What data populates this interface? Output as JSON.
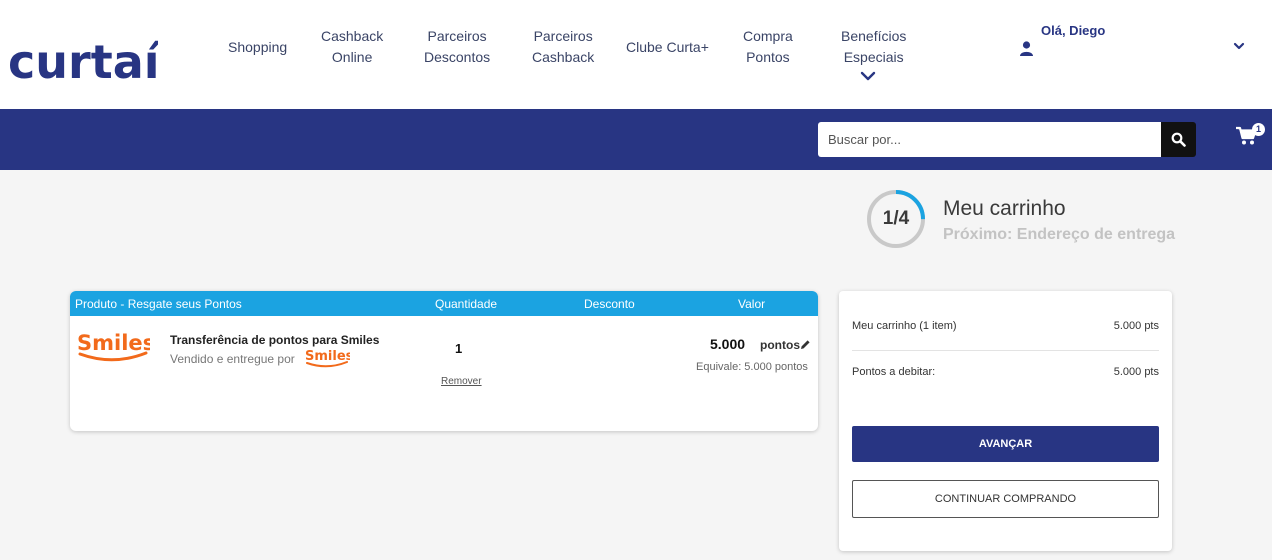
{
  "header": {
    "logo_text": "curtaí",
    "nav": [
      {
        "label_1": "Shopping",
        "label_2": ""
      },
      {
        "label_1": "Cashback",
        "label_2": "Online"
      },
      {
        "label_1": "Parceiros",
        "label_2": "Descontos"
      },
      {
        "label_1": "Parceiros",
        "label_2": "Cashback"
      },
      {
        "label_1": "Clube Curta+",
        "label_2": ""
      },
      {
        "label_1": "Compra",
        "label_2": "Pontos"
      },
      {
        "label_1": "Benefícios",
        "label_2": "Especiais"
      }
    ],
    "user": {
      "greeting": "Olá, Diego"
    }
  },
  "search": {
    "placeholder": "Buscar por..."
  },
  "cart": {
    "count": "1"
  },
  "steps": {
    "counter": "1/4",
    "title": "Meu carrinho",
    "next": "Próximo: Endereço de entrega",
    "progress": 0.25
  },
  "product_table": {
    "headers": {
      "product": "Produto - Resgate seus Pontos",
      "quantity": "Quantidade",
      "discount": "Desconto",
      "value": "Valor"
    },
    "items": [
      {
        "brand": "Smiles",
        "name": "Transferência de pontos para Smiles",
        "seller_prefix": "Vendido e entregue por",
        "seller_brand": "Smiles",
        "quantity": "1",
        "remove_label": "Remover",
        "value": "5.000",
        "unit": "pontos",
        "equivalent": "Equivale: 5.000 pontos"
      }
    ]
  },
  "summary": {
    "cart_label": "Meu carrinho (1 item)",
    "cart_value": "5.000 pts",
    "debit_label": "Pontos a debitar:",
    "debit_value": "5.000 pts",
    "advance_label": "AVANÇAR",
    "continue_label": "CONTINUAR COMPRANDO"
  },
  "colors": {
    "navy": "#283583",
    "blue": "#1ba3e1",
    "smiles_orange": "#f26a1b"
  }
}
